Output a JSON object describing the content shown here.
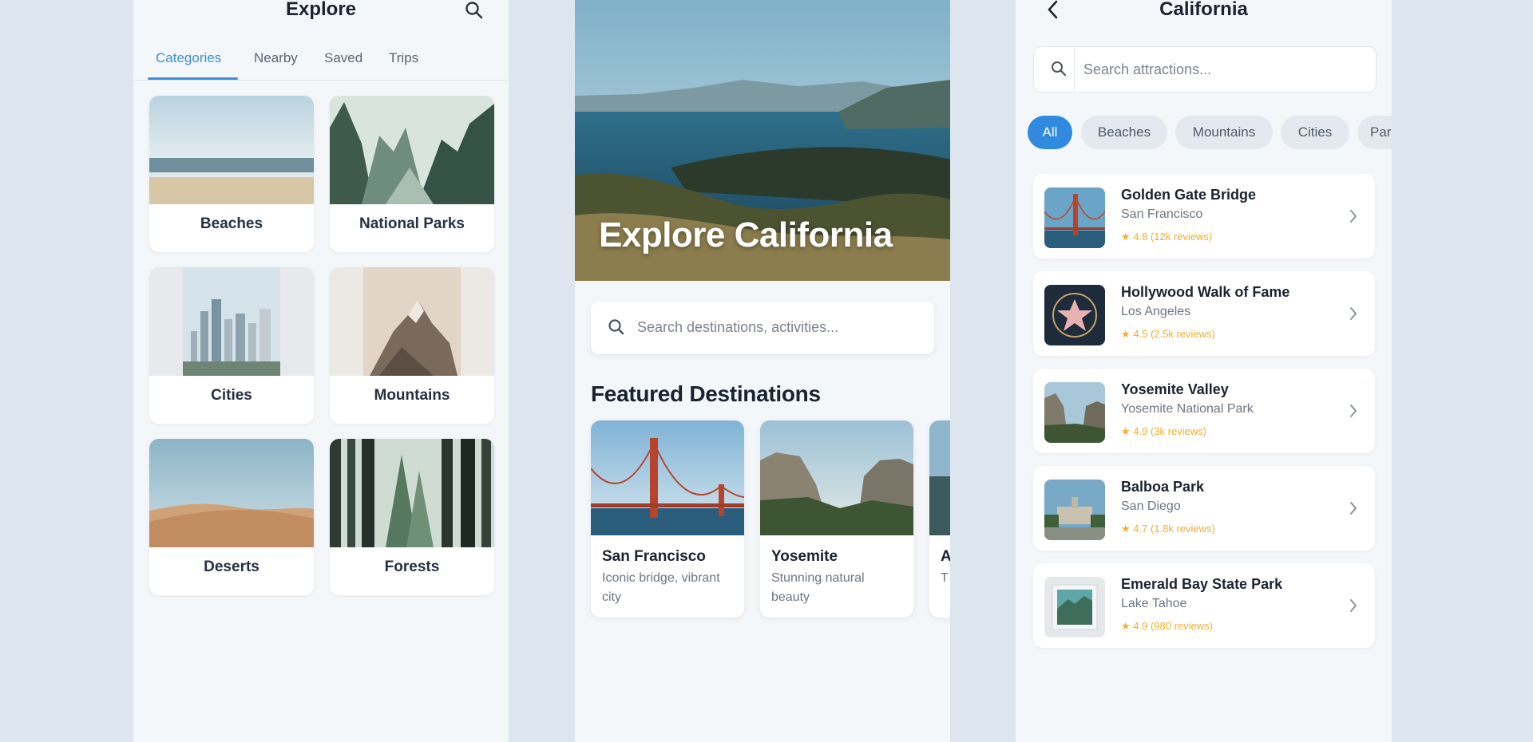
{
  "explore": {
    "title": "Explore",
    "tabs": [
      {
        "label": "Categories",
        "active": true
      },
      {
        "label": "Nearby"
      },
      {
        "label": "Saved"
      },
      {
        "label": "Trips"
      }
    ],
    "categories": [
      {
        "label": "Beaches"
      },
      {
        "label": "National Parks"
      },
      {
        "label": "Cities"
      },
      {
        "label": "Mountains"
      },
      {
        "label": "Deserts"
      },
      {
        "label": "Forests"
      }
    ]
  },
  "home": {
    "hero_title": "Explore California",
    "search_placeholder": "Search destinations, activities...",
    "featured_title": "Featured Destinations",
    "destinations": [
      {
        "name": "San Francisco",
        "desc": "Iconic bridge, vibrant city"
      },
      {
        "name": "Yosemite",
        "desc": "Stunning natural beauty"
      },
      {
        "name": "A",
        "desc": "T a"
      }
    ]
  },
  "region": {
    "title": "California",
    "search_placeholder": "Search attractions...",
    "chips": [
      {
        "label": "All",
        "active": true
      },
      {
        "label": "Beaches"
      },
      {
        "label": "Mountains"
      },
      {
        "label": "Cities"
      },
      {
        "label": "Par"
      }
    ],
    "attractions": [
      {
        "name": "Golden Gate Bridge",
        "location": "San Francisco",
        "rating": "★ 4.8 (12k reviews)"
      },
      {
        "name": "Hollywood Walk of Fame",
        "location": "Los Angeles",
        "rating": "★ 4.5 (2.5k reviews)"
      },
      {
        "name": "Yosemite Valley",
        "location": "Yosemite National Park",
        "rating": "★ 4.9 (3k reviews)"
      },
      {
        "name": "Balboa Park",
        "location": "San Diego",
        "rating": "★ 4.7 (1.8k reviews)"
      },
      {
        "name": "Emerald Bay State Park",
        "location": "Lake Tahoe",
        "rating": "★ 4.9 (980 reviews)"
      }
    ]
  },
  "colors": {
    "accent": "#2f8ae0",
    "background": "#dde6ee",
    "card": "#ffffff",
    "rating_star": "#f0ae2e"
  },
  "icons": [
    "search-icon",
    "back-arrow-icon",
    "chevron-right-icon",
    "star-icon"
  ]
}
